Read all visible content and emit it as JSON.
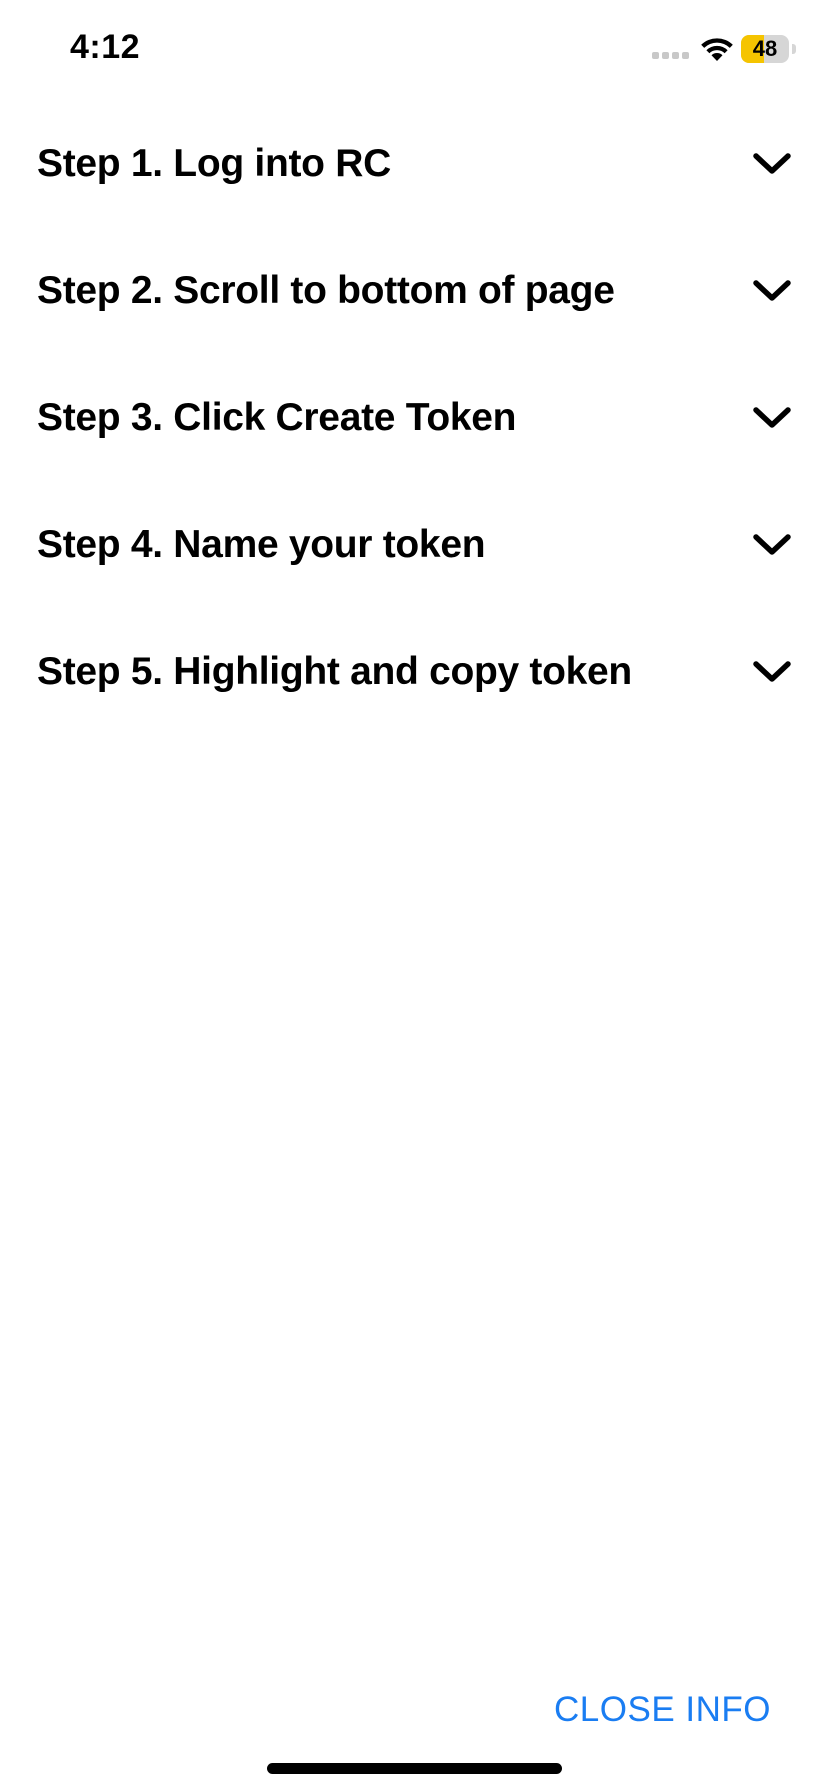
{
  "status_bar": {
    "time": "4:12",
    "battery_level": "48",
    "battery_fraction": 0.48,
    "battery_color": "#f5c400",
    "icons": [
      "cellular-signal-icon",
      "wifi-icon",
      "battery-icon"
    ]
  },
  "steps": [
    {
      "label": "Step 1. Log into RC",
      "icon": "chevron-down-icon"
    },
    {
      "label": "Step 2. Scroll to bottom of page",
      "icon": "chevron-down-icon"
    },
    {
      "label": "Step 3. Click Create Token",
      "icon": "chevron-down-icon"
    },
    {
      "label": "Step 4. Name your token",
      "icon": "chevron-down-icon"
    },
    {
      "label": "Step 5. Highlight and copy token",
      "icon": "chevron-down-icon"
    }
  ],
  "footer": {
    "close_label": "CLOSE INFO",
    "accent_color": "#1a7df2"
  }
}
